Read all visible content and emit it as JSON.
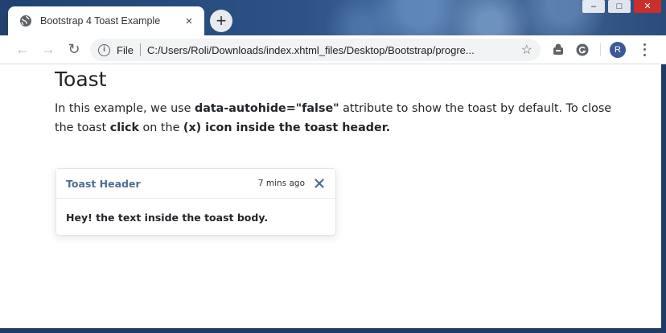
{
  "browser": {
    "tab_title": "Bootstrap 4 Toast Example",
    "tab_close": "×",
    "new_tab": "+",
    "window_controls": {
      "minimize": "–",
      "maximize": "□",
      "close": "✕"
    },
    "nav": {
      "back": "←",
      "forward": "→",
      "reload": "↻"
    },
    "omnibox": {
      "info": "i",
      "scheme_label": "File",
      "url": "C:/Users/Roli/Downloads/index.xhtml_files/Desktop/Bootstrap/progre..."
    },
    "bookmark_star": "☆",
    "profile_initial": "R",
    "icons": [
      "globe-icon",
      "info-icon",
      "star-icon",
      "extension-icon",
      "grammarly-icon",
      "menu-icon"
    ]
  },
  "page": {
    "title": "Toast",
    "intro": {
      "t1": "In this example, we use ",
      "b1": "data-autohide=\"false\"",
      "t2": " attribute to show the toast by default. To close the toast ",
      "b2": "click",
      "t3": " on the ",
      "b3": "(x) icon inside the toast header."
    }
  },
  "toast": {
    "header_title": "Toast Header",
    "time": "7 mins ago",
    "body": "Hey! the text inside the toast body."
  },
  "colors": {
    "header_title": "#4e6d93",
    "text": "#212529",
    "chrome_blue": "#1e3a66"
  }
}
